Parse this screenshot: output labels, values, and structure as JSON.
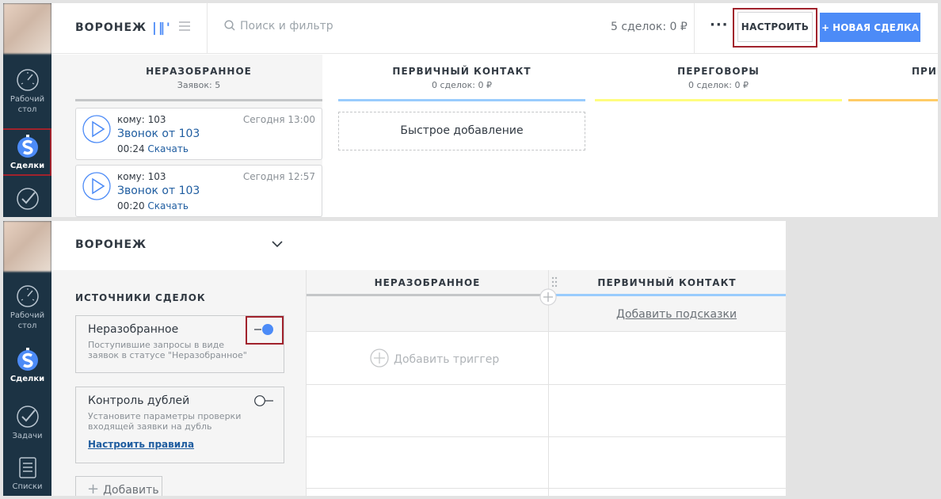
{
  "top": {
    "nav": {
      "dashboard_label": "Рабочий стол",
      "deals_label": "Сделки"
    },
    "header": {
      "pipeline": "ВОРОНЕЖ",
      "search_placeholder": "Поиск и фильтр",
      "deals_summary": "5 сделок: 0 ₽",
      "more": "···",
      "settings_button": "НАСТРОИТЬ",
      "new_deal_button": "+ НОВАЯ СДЕЛКА"
    },
    "columns": [
      {
        "name": "НЕРАЗОБРАННОЕ",
        "count": "Заявок: 5",
        "color": "#c4c6c8"
      },
      {
        "name": "ПЕРВИЧНЫЙ КОНТАКТ",
        "count": "0 сделок: 0 ₽",
        "color": "#99ccfd"
      },
      {
        "name": "ПЕРЕГОВОРЫ",
        "count": "0 сделок: 0 ₽",
        "color": "#fffd7f"
      },
      {
        "name": "ПРИН",
        "count": "",
        "color": "#ffcc66"
      }
    ],
    "cards": [
      {
        "to": "кому: 103",
        "time": "Сегодня 13:00",
        "title": "Звонок от 103",
        "duration": "00:24",
        "download": "Скачать"
      },
      {
        "to": "кому: 103",
        "time": "Сегодня 12:57",
        "title": "Звонок от 103",
        "duration": "00:20",
        "download": "Скачать"
      }
    ],
    "quick_add": "Быстрое добавление"
  },
  "bottom": {
    "nav": {
      "dashboard_label": "Рабочий стол",
      "deals_label": "Сделки",
      "tasks_label": "Задачи",
      "lists_label": "Списки"
    },
    "header": {
      "pipeline": "ВОРОНЕЖ"
    },
    "panel": {
      "title": "ИСТОЧНИКИ СДЕЛОК",
      "sources": [
        {
          "name": "Неразобранное",
          "desc": "Поступившие запросы в виде заявок в статусе \"Неразобранное\"",
          "enabled": true
        },
        {
          "name": "Контроль дублей",
          "desc": "Установите параметры проверки входящей заявки на дубль",
          "link": "Настроить правила",
          "enabled": false
        }
      ],
      "add_button": "Добавить"
    },
    "grid": {
      "columns": [
        {
          "name": "НЕРАЗОБРАННОЕ",
          "color": "#c4c6c8"
        },
        {
          "name": "ПЕРВИЧНЫЙ КОНТАКТ",
          "color": "#99ccfd"
        }
      ],
      "hint_link": "Добавить подсказки",
      "add_trigger": "Добавить триггер"
    }
  },
  "colors": {
    "nav_bg": "#1c3344",
    "accent": "#4c8bf7",
    "highlight": "#a1222c",
    "link": "#1f5da0"
  }
}
